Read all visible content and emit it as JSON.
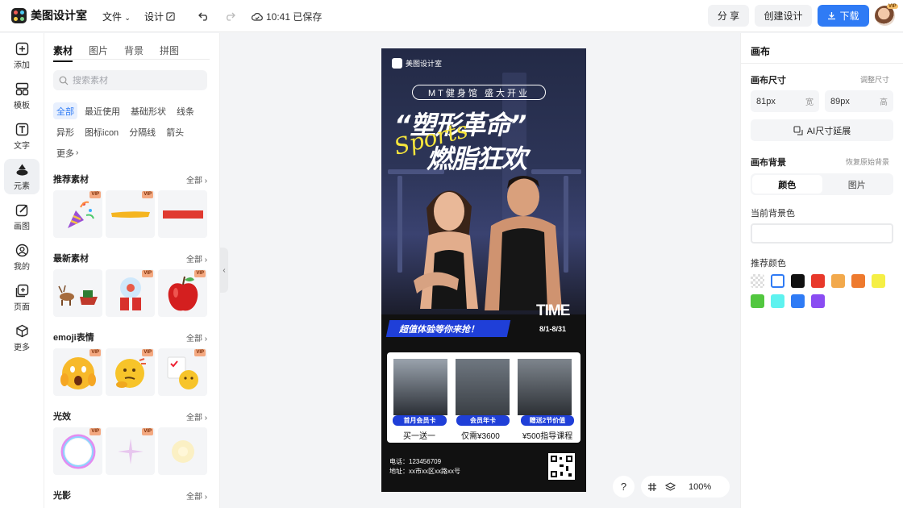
{
  "app": {
    "name": "美图设计室"
  },
  "topbar": {
    "file_label": "文件",
    "design_label": "设计",
    "save_time": "10:41 已保存",
    "share_label": "分 享",
    "create_label": "创建设计",
    "download_label": "下载",
    "avatar_badge": "VIP"
  },
  "rail": [
    {
      "label": "添加",
      "icon": "plus-square-icon"
    },
    {
      "label": "模板",
      "icon": "template-icon"
    },
    {
      "label": "文字",
      "icon": "text-icon"
    },
    {
      "label": "元素",
      "icon": "shapes-icon",
      "active": true
    },
    {
      "label": "画图",
      "icon": "draw-icon"
    },
    {
      "label": "我的",
      "icon": "user-icon"
    },
    {
      "label": "页面",
      "icon": "page-icon"
    },
    {
      "label": "更多",
      "icon": "cube-icon"
    }
  ],
  "panel": {
    "tabs": [
      "素材",
      "图片",
      "背景",
      "拼图"
    ],
    "active_tab": "素材",
    "search_placeholder": "搜索素材",
    "filters": [
      "全部",
      "最近使用",
      "基础形状",
      "线条",
      "异形",
      "图标icon",
      "分隔线",
      "箭头",
      "更多"
    ],
    "active_filter": "全部",
    "all_label": "全部",
    "vip_label": "VIP",
    "sections": [
      {
        "title": "推荐素材",
        "items": [
          "party-popper",
          "yellow-brush-stroke",
          "red-brush-stroke"
        ]
      },
      {
        "title": "最新素材",
        "items": [
          "reindeer-sleigh",
          "snow-globe-gift",
          "red-apple"
        ]
      },
      {
        "title": "emoji表情",
        "items": [
          "shocked-emoji",
          "thinking-emoji",
          "checklist-emoji"
        ]
      },
      {
        "title": "光效",
        "items": [
          "bubble-ring",
          "sparkle-star",
          "soft-glow"
        ]
      },
      {
        "title": "光影",
        "items": []
      }
    ]
  },
  "poster": {
    "brand": "美图设计室",
    "pill_text": "MT健身馆 盛大开业",
    "title_line1": "“塑形革命”",
    "title_line2": "燃脂狂欢",
    "script_word": "Sports",
    "time_word": "TIME",
    "time_range": "8/1-8/31",
    "banner_text": "超值体验等你来抢！",
    "offers": [
      {
        "badge": "首月会员卡",
        "desc": "买一送一"
      },
      {
        "badge": "会员年卡",
        "desc": "仅需¥3600"
      },
      {
        "badge": "赠送2节价值",
        "desc": "¥500指导课程"
      }
    ],
    "contact_phone": "电话：123456709",
    "contact_address": "地址：xx市xx区xx路xx号"
  },
  "canvas_controls": {
    "help": "?",
    "zoom": "100%"
  },
  "properties": {
    "title": "画布",
    "size_label": "画布尺寸",
    "size_adjust": "调整尺寸",
    "width_value": "81px",
    "width_unit": "宽",
    "height_value": "89px",
    "height_unit": "高",
    "ai_extend_label": "AI尺寸延展",
    "bg_label": "画布背景",
    "bg_restore": "恢复原始背景",
    "bg_tabs": [
      "颜色",
      "图片"
    ],
    "current_color_label": "当前背景色",
    "recommended_label": "推荐颜色",
    "swatches": [
      "transparent",
      "#ffffff",
      "#111111",
      "#e8392b",
      "#f2a94c",
      "#ee7a2e",
      "#f5ef45",
      "#52c73f",
      "#5ef2ef",
      "#2f7bf5",
      "#8a4cf2"
    ]
  }
}
